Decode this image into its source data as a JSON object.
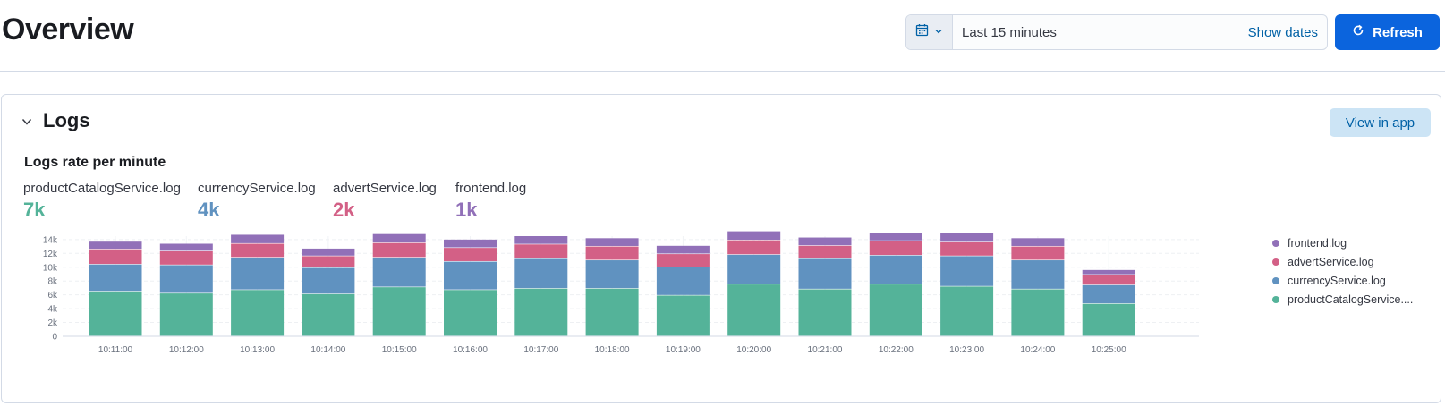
{
  "header": {
    "title": "Overview",
    "date_picker": {
      "label": "Last 15 minutes",
      "show_dates": "Show dates",
      "quick_icon": "calendar-icon"
    },
    "refresh_label": "Refresh",
    "refresh_icon": "refresh-icon"
  },
  "panel": {
    "title": "Logs",
    "collapse_icon": "chevron-down-icon",
    "view_in_app": "View in app",
    "chart_title": "Logs rate per minute",
    "stats": [
      {
        "label": "productCatalogService.log",
        "value": "7k",
        "color": "#54b399"
      },
      {
        "label": "currencyService.log",
        "value": "4k",
        "color": "#6092c0"
      },
      {
        "label": "advertService.log",
        "value": "2k",
        "color": "#d36086"
      },
      {
        "label": "frontend.log",
        "value": "1k",
        "color": "#9170b8"
      }
    ],
    "legend": [
      {
        "label": "frontend.log",
        "color": "#9170b8"
      },
      {
        "label": "advertService.log",
        "color": "#d36086"
      },
      {
        "label": "currencyService.log",
        "color": "#6092c0"
      },
      {
        "label": "productCatalogService....",
        "color": "#54b399"
      }
    ]
  },
  "chart_data": {
    "type": "bar",
    "stacked": true,
    "title": "Logs rate per minute",
    "categories": [
      "10:11:00",
      "10:12:00",
      "10:13:00",
      "10:14:00",
      "10:15:00",
      "10:16:00",
      "10:17:00",
      "10:18:00",
      "10:19:00",
      "10:20:00",
      "10:21:00",
      "10:22:00",
      "10:23:00",
      "10:24:00",
      "10:25:00"
    ],
    "series": [
      {
        "name": "productCatalogService.log",
        "color": "#54b399",
        "values": [
          6500,
          6200,
          6700,
          6100,
          7100,
          6700,
          6900,
          6900,
          5900,
          7500,
          6800,
          7500,
          7200,
          6800,
          4700
        ]
      },
      {
        "name": "currencyService.log",
        "color": "#6092c0",
        "values": [
          3900,
          4100,
          4700,
          3800,
          4300,
          4100,
          4300,
          4100,
          4100,
          4300,
          4400,
          4200,
          4400,
          4200,
          2700
        ]
      },
      {
        "name": "advertService.log",
        "color": "#d36086",
        "values": [
          2200,
          2000,
          2000,
          1700,
          2100,
          2000,
          2100,
          2000,
          1900,
          2100,
          1900,
          2100,
          2000,
          2000,
          1500
        ]
      },
      {
        "name": "frontend.log",
        "color": "#9170b8",
        "values": [
          1100,
          1100,
          1300,
          1100,
          1300,
          1200,
          1200,
          1200,
          1200,
          1300,
          1200,
          1200,
          1300,
          1200,
          700
        ]
      }
    ],
    "yticks": [
      "0",
      "2k",
      "4k",
      "6k",
      "8k",
      "10k",
      "12k",
      "14k"
    ],
    "ylim": [
      0,
      14500
    ],
    "grid": true,
    "legend_position": "right"
  }
}
